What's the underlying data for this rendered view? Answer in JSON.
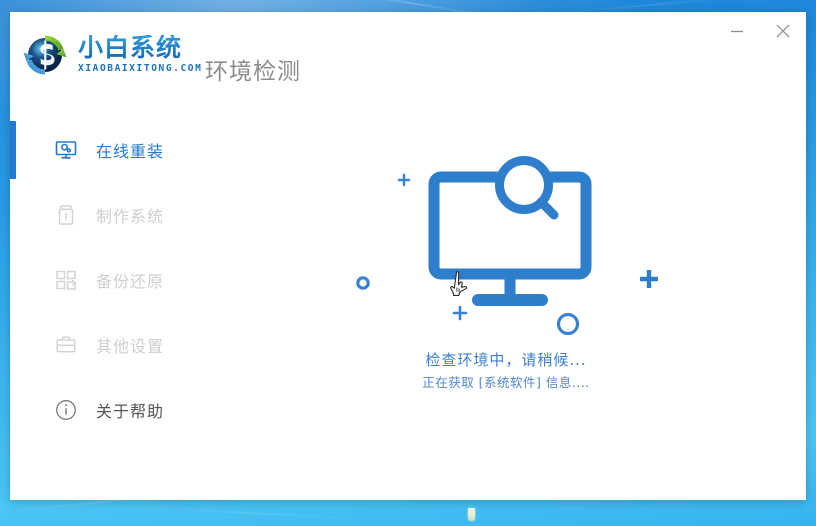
{
  "window": {
    "minimize_label": "—",
    "close_label": "✕",
    "minimize_icon": "minimize-icon",
    "close_icon": "close-icon"
  },
  "header": {
    "brand_cn": "小白系统",
    "brand_en": "XIAOBAIXITONG.COM",
    "logo_icon": "recycle-arrows-logo",
    "page_title": "环境检测"
  },
  "sidebar": {
    "items": [
      {
        "label": "在线重装",
        "icon": "monitor-online-icon",
        "state": "active"
      },
      {
        "label": "制作系统",
        "icon": "usb-drive-icon",
        "state": "disabled"
      },
      {
        "label": "备份还原",
        "icon": "grid-blocks-icon",
        "state": "disabled"
      },
      {
        "label": "其他设置",
        "icon": "toolbox-icon",
        "state": "disabled"
      },
      {
        "label": "关于帮助",
        "icon": "info-circle-icon",
        "state": "normal"
      }
    ]
  },
  "main": {
    "illustration_icon": "monitor-magnifier-scan-icon",
    "cursor_icon": "hand-pointer-cursor",
    "status_main": "检查环境中，请稍候...",
    "status_sub": "正在获取 [系统软件] 信息...."
  },
  "colors": {
    "accent_blue": "#2279cf",
    "illustration_blue": "#2e7ecb",
    "status_blue": "#3d7fd0",
    "title_gray": "#8c8c8c",
    "disabled_gray": "#cfcfcf",
    "desktop_blue": "#2091e0",
    "window_bg": "#ffffff"
  }
}
